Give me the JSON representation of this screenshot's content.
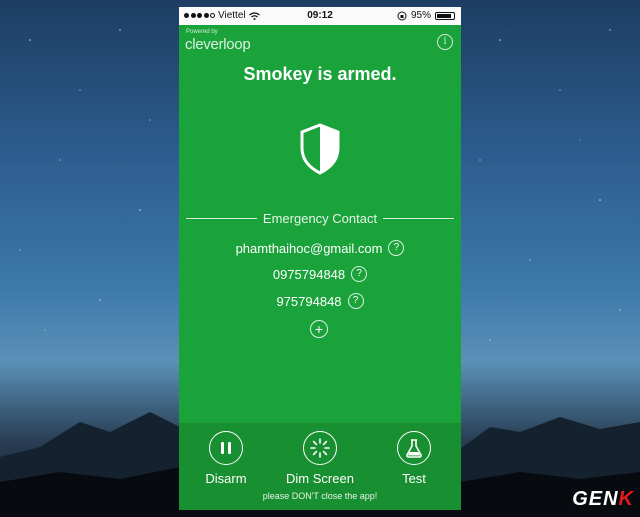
{
  "statusbar": {
    "carrier": "Viettel",
    "time": "09:12",
    "battery": "95%"
  },
  "branding": {
    "powered_by": "Powered by",
    "logo": "cleverloop"
  },
  "info_icon": "i",
  "main": {
    "title": "Smokey is armed."
  },
  "emergency": {
    "header": "Emergency Contact",
    "contacts": [
      "phamthaihoc@gmail.com",
      "0975794848",
      "975794848"
    ],
    "help_glyph": "?",
    "add_glyph": "+"
  },
  "actions": [
    {
      "label": "Disarm",
      "icon": "pause-icon"
    },
    {
      "label": "Dim Screen",
      "icon": "dim-screen-icon"
    },
    {
      "label": "Test",
      "icon": "flask-icon"
    }
  ],
  "footer": {
    "warning": "please DON'T close the app!"
  },
  "watermark": {
    "text": "GEN",
    "accent": "K"
  },
  "colors": {
    "app_green": "#1aa33a",
    "footer_green": "#188f30",
    "watermark_accent": "#e21b1b"
  }
}
